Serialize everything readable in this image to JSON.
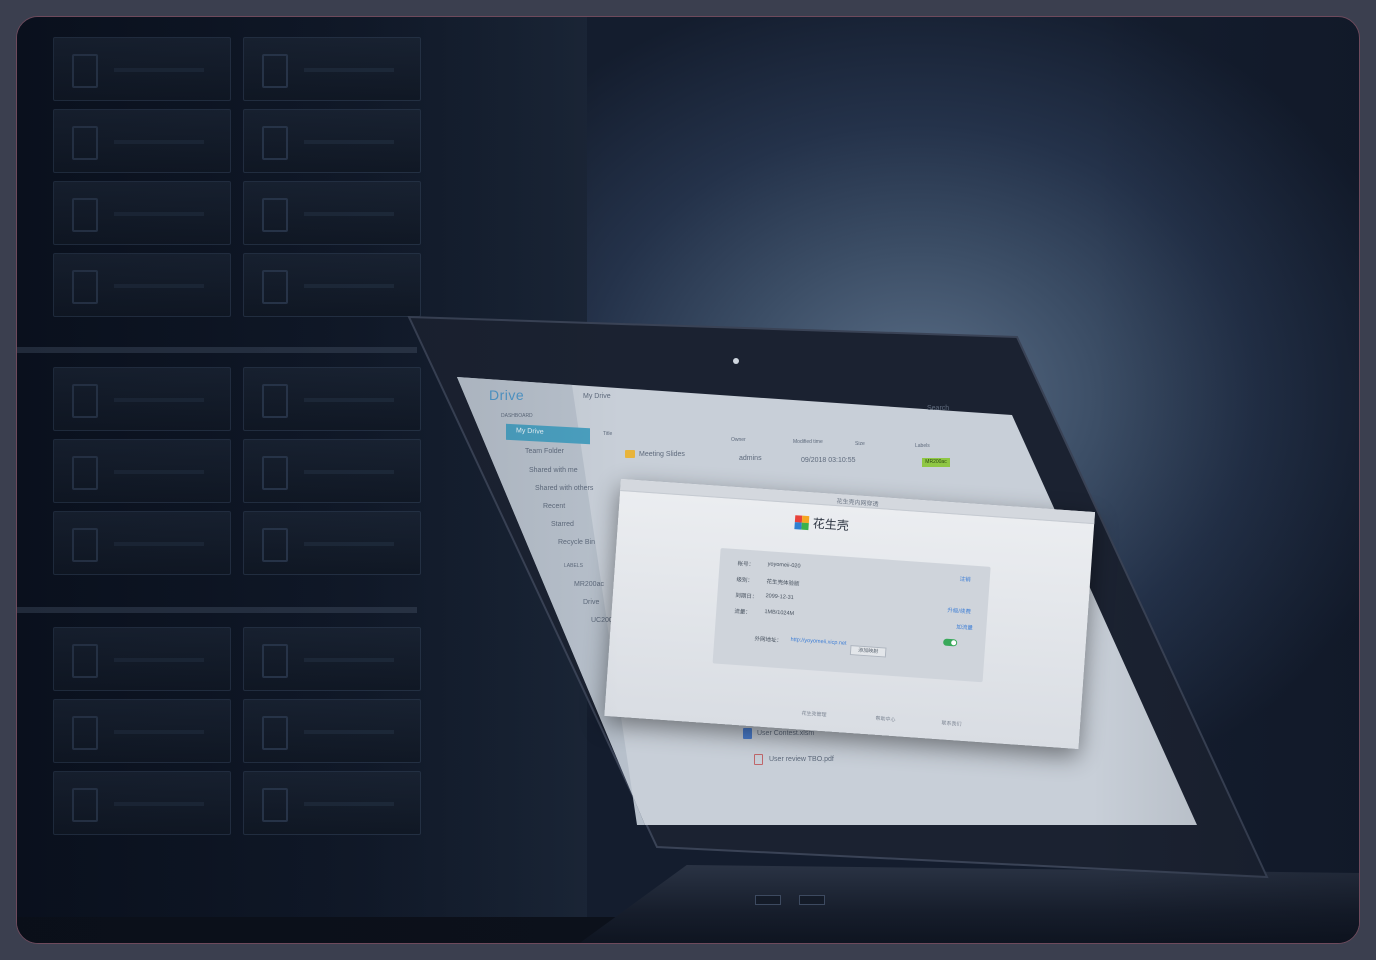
{
  "drive": {
    "logo": "Drive",
    "breadcrumb": "My Drive",
    "sidebar_header": "DASHBOARD",
    "sidebar_items": [
      "My Drive",
      "Team Folder",
      "Shared with me",
      "Shared with others",
      "Recent",
      "Starred",
      "Recycle Bin"
    ],
    "labels_header": "LABELS",
    "labels": [
      "MR200ac",
      "Drive",
      "UC200"
    ],
    "search_placeholder": "Search",
    "columns": [
      "Title",
      "Owner",
      "Modified time",
      "Size",
      "Labels"
    ],
    "rows": [
      {
        "title": "Meeting Slides",
        "owner": "admins",
        "modified": "09/2018 03:10:55",
        "tag": "MR200ac"
      },
      {
        "title": "User Contest.xlsm",
        "owner": "",
        "modified": "",
        "tag": ""
      },
      {
        "title": "User review TBO.pdf",
        "owner": "",
        "modified": "",
        "tag": ""
      }
    ]
  },
  "dialog": {
    "title": "花生壳内网穿透",
    "brand": "花生壳",
    "fields": [
      {
        "label": "帐号：",
        "value": "yoyomeii-020",
        "action": "注销"
      },
      {
        "label": "级别：",
        "value": "花生壳体验版",
        "action": ""
      },
      {
        "label": "到期日：",
        "value": "2099-12-31",
        "action": "升级/续费"
      },
      {
        "label": "流量：",
        "value": "1MB/1024M",
        "action": "加流量"
      }
    ],
    "url_label": "外网地址：",
    "url": "http://yoyomeii.xicp.net",
    "button": "添加映射",
    "footer": [
      "花生壳管理",
      "帮助中心",
      "联系我们"
    ]
  },
  "colors": {
    "accent": "#4a9fbf",
    "tag": "#8fc744",
    "toggle": "#39a95a",
    "link": "#3f7fd6"
  }
}
